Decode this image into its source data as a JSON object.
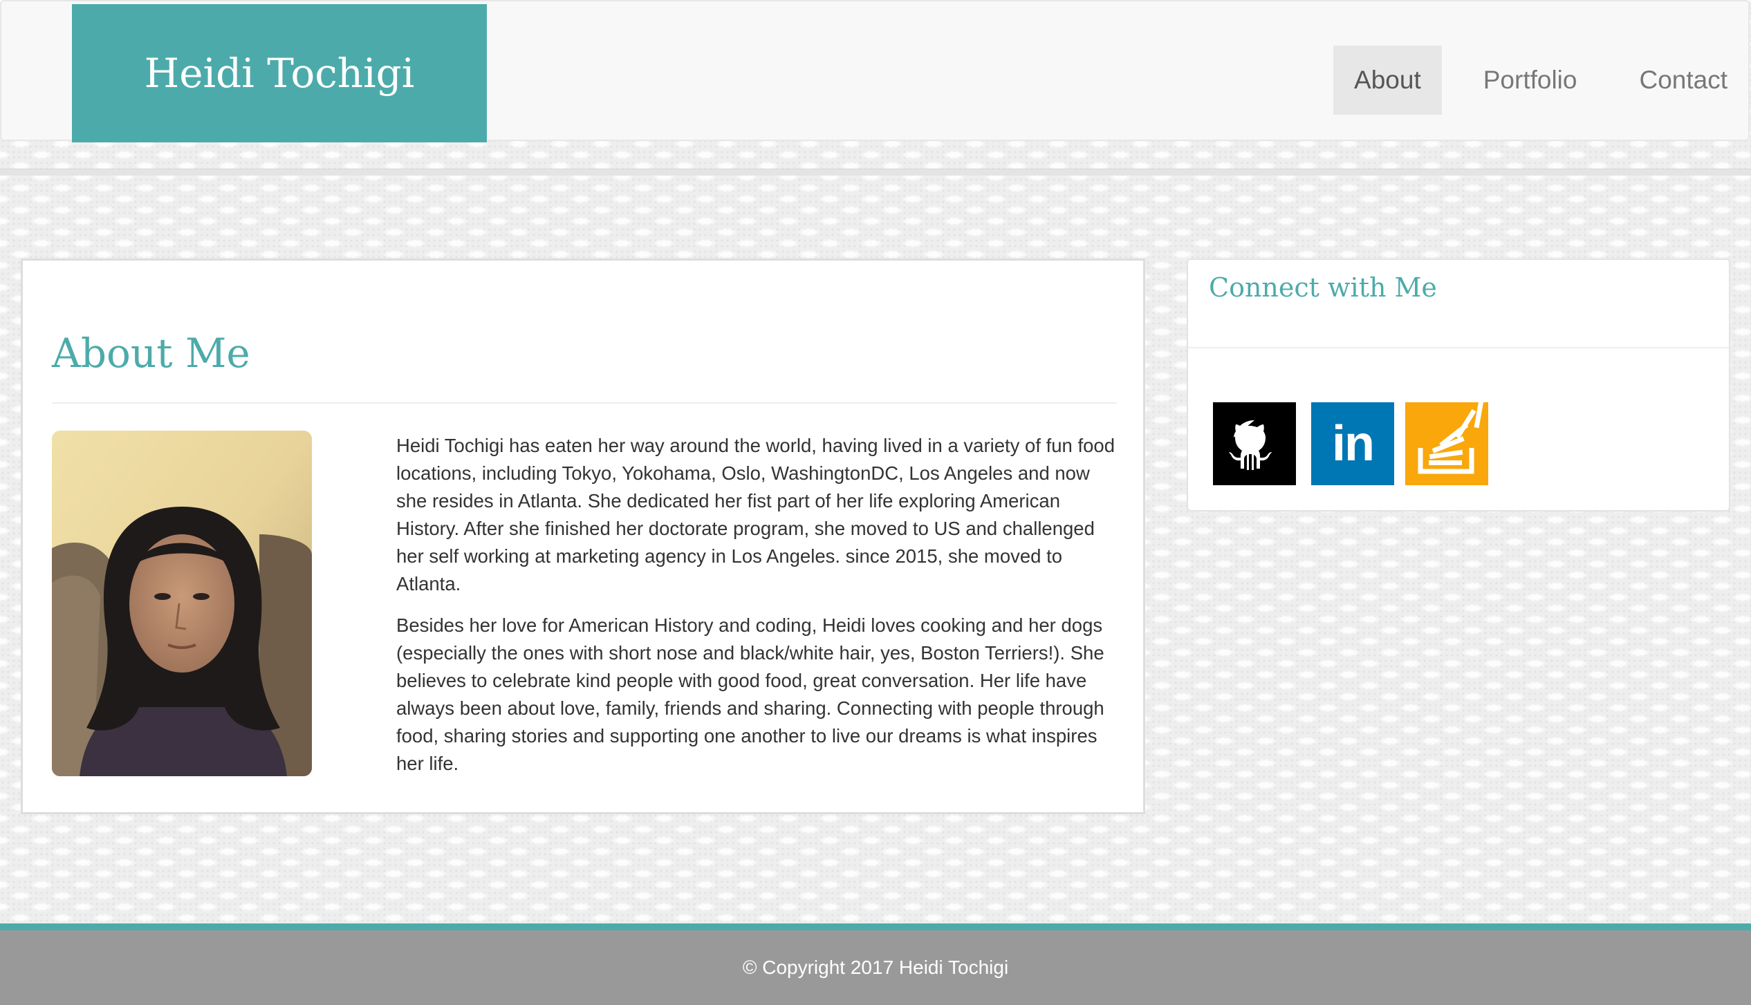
{
  "navbar": {
    "brand": "Heidi Tochigi",
    "items": [
      {
        "label": "About",
        "active": true
      },
      {
        "label": "Portfolio",
        "active": false
      },
      {
        "label": "Contact",
        "active": false
      }
    ]
  },
  "about": {
    "title": "About Me",
    "paragraphs": [
      "Heidi Tochigi has eaten her way around the world, having lived in a variety of fun food locations, including Tokyo, Yokohama, Oslo, WashingtonDC, Los Angeles and now she resides in Atlanta. She dedicated her fist part of her life exploring American History. After she finished her doctorate program, she moved to US and challenged her self working at marketing agency in Los Angeles. since 2015, she moved to Atlanta.",
      "Besides her love for American History and coding, Heidi loves cooking and her dogs (especially the ones with short nose and black/white hair, yes, Boston Terriers!). She believes to celebrate kind people with good food, great conversation. Her life have always been about love, family, friends and sharing. Connecting with people through food, sharing stories and supporting one another to live our dreams is what inspires her life."
    ]
  },
  "connect": {
    "title": "Connect with Me",
    "links": [
      {
        "name": "github",
        "icon": "github-icon",
        "color": "#000000"
      },
      {
        "name": "linkedin",
        "icon": "linkedin-icon",
        "color": "#0077b5",
        "text": "in"
      },
      {
        "name": "stackoverflow",
        "icon": "stackoverflow-icon",
        "color": "#f9a70b"
      }
    ]
  },
  "footer": {
    "text": "© Copyright 2017 Heidi Tochigi"
  },
  "colors": {
    "accent": "#4cabaa",
    "footer_bg": "#999999",
    "nav_bg": "#f8f8f8"
  }
}
